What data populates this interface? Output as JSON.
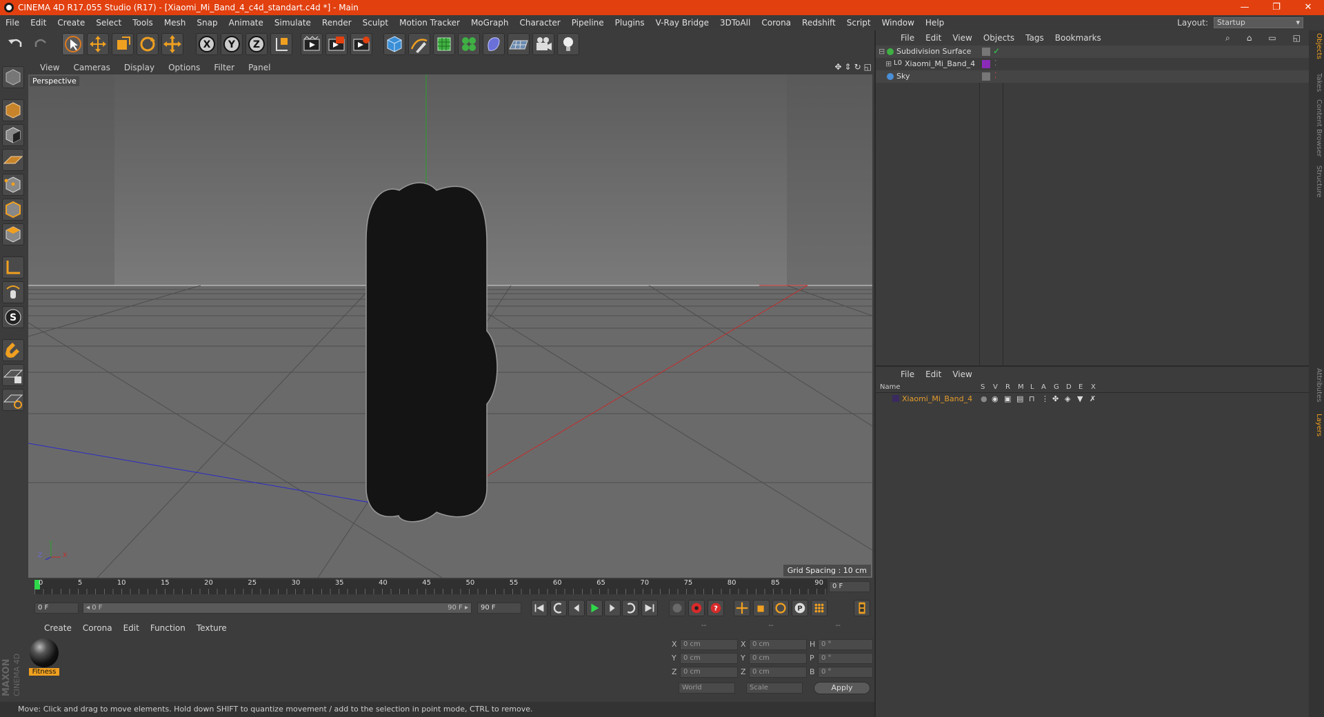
{
  "window": {
    "title": "CINEMA 4D R17.055 Studio (R17) - [Xiaomi_Mi_Band_4_c4d_standart.c4d *] - Main",
    "controls": [
      "—",
      "❐",
      "✕"
    ]
  },
  "menubar": {
    "items": [
      "File",
      "Edit",
      "Create",
      "Select",
      "Tools",
      "Mesh",
      "Snap",
      "Animate",
      "Simulate",
      "Render",
      "Sculpt",
      "Motion Tracker",
      "MoGraph",
      "Character",
      "Pipeline",
      "Plugins",
      "V-Ray Bridge",
      "3DToAll",
      "Corona",
      "Redshift",
      "Script",
      "Window",
      "Help"
    ],
    "layout_label": "Layout:",
    "layout_value": "Startup"
  },
  "toolbar": {
    "icons": [
      "undo-icon",
      "redo-icon",
      "select-icon",
      "move-icon",
      "scale-icon",
      "rotate-icon",
      "live-move-icon",
      "x-axis-icon",
      "y-axis-icon",
      "z-axis-icon",
      "coordinate-system-icon",
      "render-view-icon",
      "render-picture-viewer-icon",
      "edit-render-settings-icon",
      "cube-icon",
      "pen-spline-icon",
      "subdivision-icon",
      "cloner-icon",
      "deformer-icon",
      "floor-icon",
      "camera-icon",
      "light-icon"
    ]
  },
  "viewport": {
    "menu": [
      "View",
      "Cameras",
      "Display",
      "Options",
      "Filter",
      "Panel"
    ],
    "label": "Perspective",
    "grid_spacing": "Grid Spacing : 10 cm",
    "axis_labels": {
      "y": "Y",
      "x": "X",
      "z": "Z"
    }
  },
  "timeline": {
    "ticks": [
      "0",
      "5",
      "10",
      "15",
      "20",
      "25",
      "30",
      "35",
      "40",
      "45",
      "50",
      "55",
      "60",
      "65",
      "70",
      "75",
      "80",
      "85",
      "90"
    ],
    "current_frame": "0 F",
    "start_field": "0 F",
    "range_start": "◂ 0 F",
    "range_end": "90 F ▸",
    "end_field": "90 F"
  },
  "materials": {
    "menu": [
      "Create",
      "Corona",
      "Edit",
      "Function",
      "Texture"
    ],
    "items": [
      {
        "name": "Fitness"
      }
    ]
  },
  "coordinates": {
    "header": [
      "--",
      "--",
      "--"
    ],
    "rows": [
      {
        "a_label": "X",
        "a_val": "0 cm",
        "b_label": "X",
        "b_val": "0 cm",
        "c_label": "H",
        "c_val": "0 °"
      },
      {
        "a_label": "Y",
        "a_val": "0 cm",
        "b_label": "Y",
        "b_val": "0 cm",
        "c_label": "P",
        "c_val": "0 °"
      },
      {
        "a_label": "Z",
        "a_val": "0 cm",
        "b_label": "Z",
        "b_val": "0 cm",
        "c_label": "B",
        "c_val": "0 °"
      }
    ],
    "mode1": "World",
    "mode2": "Scale",
    "apply": "Apply"
  },
  "maxon": {
    "brand": "MAXON",
    "product": "CINEMA 4D"
  },
  "object_manager": {
    "menu": [
      "File",
      "Edit",
      "View",
      "Objects",
      "Tags",
      "Bookmarks"
    ],
    "objects": [
      {
        "name": "Subdivision Surface",
        "color": "#3fb043"
      },
      {
        "name": "Xiaomi_Mi_Band_4",
        "color": "#8a8a8a"
      },
      {
        "name": "Sky",
        "color": "#4a8fd8"
      }
    ]
  },
  "layer_manager": {
    "menu": [
      "File",
      "Edit",
      "View"
    ],
    "columns": [
      "Name",
      "S",
      "V",
      "R",
      "M",
      "L",
      "A",
      "G",
      "D",
      "E",
      "X"
    ],
    "layers": [
      {
        "name": "Xiaomi_Mi_Band_4",
        "color": "#e39b2c"
      }
    ]
  },
  "side_tabs": [
    "Objects",
    "Takes",
    "Content Browser",
    "Structure",
    "Attributes",
    "Layers"
  ],
  "status": "Move: Click and drag to move elements. Hold down SHIFT to quantize movement / add to the selection in point mode, CTRL to remove."
}
